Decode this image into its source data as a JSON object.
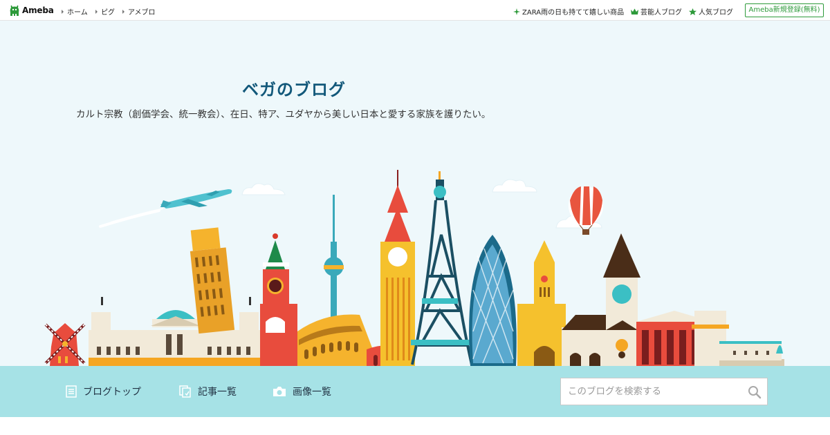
{
  "topbar": {
    "logo_text": "Ameba",
    "nav": [
      {
        "label": "ホーム"
      },
      {
        "label": "ピグ"
      },
      {
        "label": "アメブロ"
      }
    ],
    "right_links": [
      {
        "label": "ZARA雨の日も持てて嬉しい商品",
        "icon": "sparkle-icon"
      },
      {
        "label": "芸能人ブログ",
        "icon": "crown-icon"
      },
      {
        "label": "人気ブログ",
        "icon": "star-icon"
      }
    ],
    "register_label": "Ameba新規登録(無料)"
  },
  "header": {
    "title": "ベガのブログ",
    "description": "カルト宗教（創価学会、統一教会）、在日、特ア、ユダヤから美しい日本と愛する家族を護りたい。"
  },
  "blognav": {
    "items": [
      {
        "label": "ブログトップ",
        "icon": "document-icon"
      },
      {
        "label": "記事一覧",
        "icon": "articles-icon"
      },
      {
        "label": "画像一覧",
        "icon": "camera-icon"
      }
    ],
    "search_placeholder": "このブログを検索する"
  },
  "colors": {
    "accent_green": "#2d9a3a",
    "title_blue": "#12587a",
    "header_bg": "#eef8fb",
    "nav_bg": "#a6e2e6"
  }
}
